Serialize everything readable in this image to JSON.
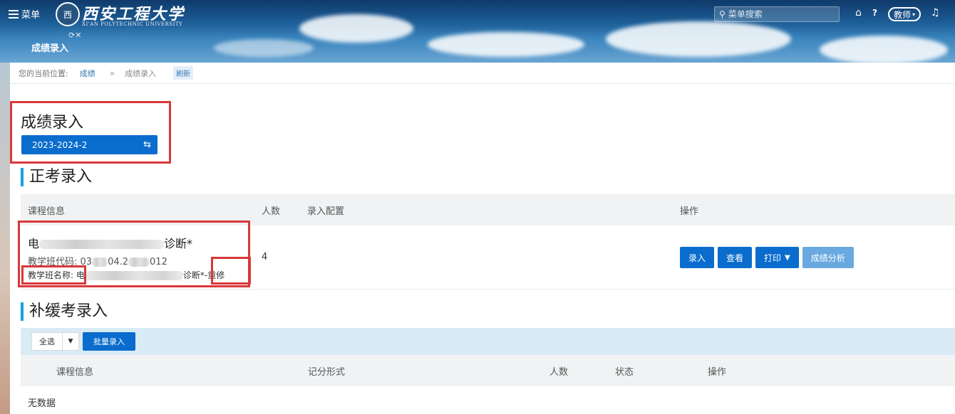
{
  "header": {
    "menu_label": "菜单",
    "logo_seal": "西",
    "university_name": "西安工程大学",
    "university_en": "XI'AN POLYTECHNIC UNIVERSITY",
    "search_placeholder": "菜单搜索",
    "role_label": "教师",
    "nav_tab": "成绩录入"
  },
  "breadcrumb": {
    "prefix": "您的当前位置:",
    "level1": "成绩",
    "separator": "»",
    "level2": "成绩录入",
    "refresh": "刷新"
  },
  "page": {
    "title": "成绩录入",
    "term": "2023-2024-2"
  },
  "regular": {
    "title": "正考录入",
    "headers": {
      "course_info": "课程信息",
      "count": "人数",
      "config": "录入配置",
      "actions": "操作"
    },
    "row": {
      "course_name_start": "电",
      "course_name_end": "诊断*",
      "code_label": "教学班代码:",
      "code_part1": "03",
      "code_part2": "04.2",
      "code_part3": "012",
      "class_label": "教学班名称:",
      "class_start": "电",
      "class_end": "诊断*-重修",
      "count": "4"
    },
    "actions": {
      "enter": "录入",
      "view": "查看",
      "print": "打印",
      "analysis": "成绩分析"
    }
  },
  "makeup": {
    "title": "补缓考录入",
    "select_all": "全选",
    "batch_enter": "批量录入",
    "headers": {
      "course_info": "课程信息",
      "grading": "记分形式",
      "count": "人数",
      "status": "状态",
      "actions": "操作"
    },
    "empty": "无数据"
  },
  "colors": {
    "primary": "#0a6ccd",
    "highlight": "#d9383a",
    "accent_bar": "#1aa0d9"
  }
}
